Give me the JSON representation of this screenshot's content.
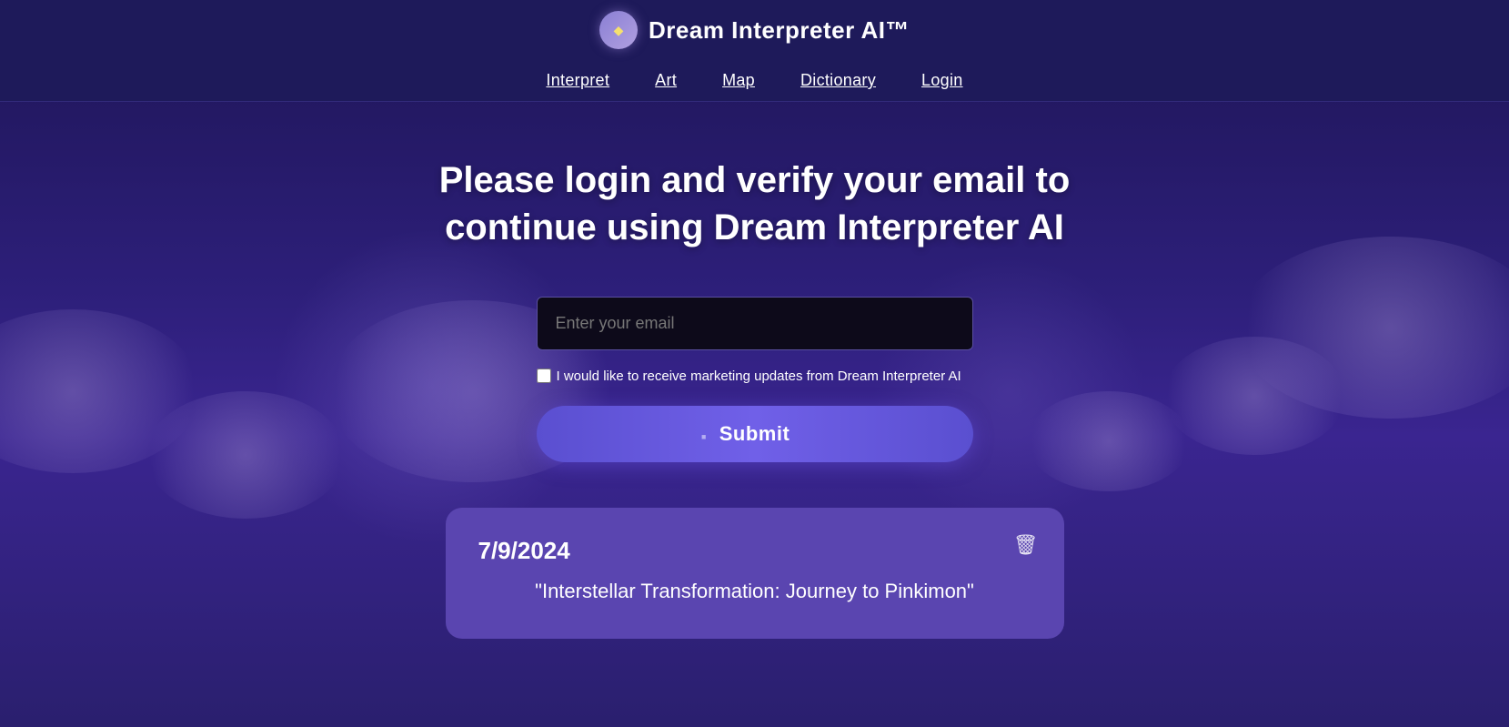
{
  "header": {
    "brand": {
      "logo_symbol": "◆",
      "title": "Dream Interpreter AI™"
    },
    "nav": {
      "items": [
        {
          "label": "Interpret",
          "url": "#"
        },
        {
          "label": "Art",
          "url": "#"
        },
        {
          "label": "Map",
          "url": "#"
        },
        {
          "label": "Dictionary",
          "url": "#"
        },
        {
          "label": "Login",
          "url": "#"
        }
      ]
    }
  },
  "main": {
    "heading": "Please login and verify your email to continue using Dream Interpreter AI",
    "email_input": {
      "placeholder": "Enter your email",
      "value": ""
    },
    "checkbox": {
      "label": "I would like to receive marketing updates from Dream Interpreter AI",
      "checked": false
    },
    "submit_button": "Submit"
  },
  "dream_card": {
    "date": "7/9/2024",
    "title": "\"Interstellar Transformation: Journey to Pinkimon\"",
    "delete_icon": "🗑"
  }
}
